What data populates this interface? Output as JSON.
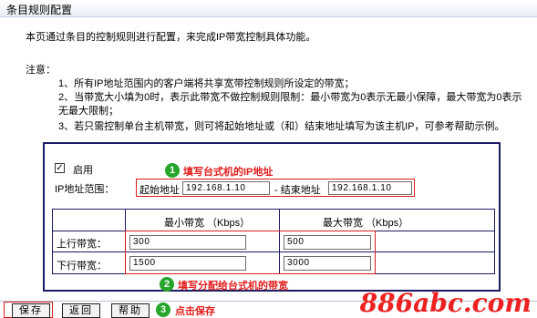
{
  "header": {
    "title": "条目规则配置"
  },
  "intro": "本页通过条目的控制规则进行配置，来完成IP带宽控制具体功能。",
  "notes": {
    "label": "注意：",
    "lines": [
      "1、所有IP地址范围内的客户端将共享宽带控制规则所设定的带宽；",
      "2、当带宽大小填为0时，表示此带宽不做控制规则限制：最小带宽为0表示无最小保障，最大带宽为0表示",
      "无最大限制；",
      "3、若只需控制单台主机带宽，则可将起始地址或（和）结束地址填写为该主机IP，可参考帮助示例。"
    ]
  },
  "form": {
    "enable_label": "启用",
    "enable_checked": "✓",
    "ip_range_label": "IP地址范围：",
    "start_label": "起始地址",
    "start_value": "192.168.1.10",
    "end_label": "- 结束地址",
    "end_value": "192.168.1.10"
  },
  "bandwidth_table": {
    "headers": [
      "最小带宽 （Kbps）",
      "最大带宽 （Kbps）"
    ],
    "rows": [
      {
        "label": "上行带宽：",
        "min": "300",
        "max": "500"
      },
      {
        "label": "下行带宽：",
        "min": "1500",
        "max": "3000"
      }
    ]
  },
  "annotations": [
    {
      "num": "1",
      "text": "填写台式机的IP地址"
    },
    {
      "num": "2",
      "text": "填写分配给台式机的带宽"
    },
    {
      "num": "3",
      "text": "点击保存"
    }
  ],
  "buttons": {
    "save": "保存",
    "back": "返回",
    "help": "帮助"
  },
  "watermark": "886abc.com",
  "colors": {
    "annotation_red": "#e41d1d",
    "badge_green": "#25a62a",
    "panel_border": "#1b1b63"
  }
}
